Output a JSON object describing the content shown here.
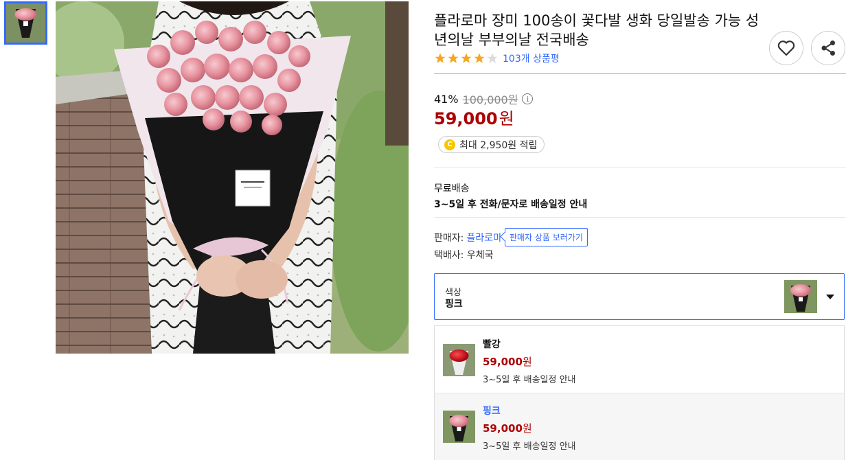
{
  "product": {
    "title": "플라로마 장미 100송이 꽃다발 생화 당일발송 가능 성년의날 부부의날 전국배송",
    "rating_stars": 4,
    "rating_max": 5,
    "review_count": "103개 상품평",
    "discount_rate": "41%",
    "original_price": "100,000원",
    "sale_price": "59,000",
    "currency": "원",
    "point_text": "최대 2,950원 적립",
    "point_icon": "coin-icon"
  },
  "shipping": {
    "type": "무료배송",
    "info": "3~5일 후 전화/문자로 배송일정 안내"
  },
  "seller": {
    "label": "판매자:",
    "name": "플라로마",
    "link": "판매자 상품 보러가기",
    "courier_label": "택배사:",
    "courier": "우체국"
  },
  "option": {
    "label": "색상",
    "selected": "핑크",
    "items": [
      {
        "name": "빨강",
        "price": "59,000",
        "currency": "원",
        "ship": "3~5일 후 배송일정 안내"
      },
      {
        "name": "핑크",
        "price": "59,000",
        "currency": "원",
        "ship": "3~5일 후 배송일정 안내"
      }
    ]
  },
  "colors": {
    "accent": "#346aff",
    "price": "#ae0000",
    "star": "#f5a623"
  }
}
